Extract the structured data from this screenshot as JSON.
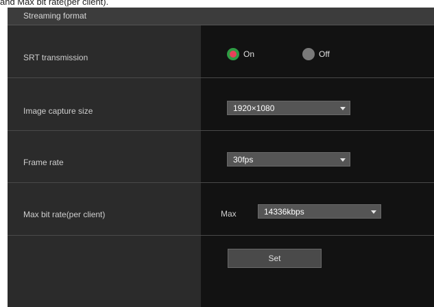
{
  "caption": "and Max bit rate(per client).",
  "section_title": "Streaming format",
  "srt": {
    "label": "SRT transmission",
    "on_label": "On",
    "off_label": "Off",
    "selected": "On"
  },
  "image_capture": {
    "label": "Image capture size",
    "value": "1920×1080"
  },
  "frame_rate": {
    "label": "Frame rate",
    "value": "30fps"
  },
  "max_bitrate": {
    "label": "Max bit rate(per client)",
    "prefix": "Max",
    "value": "14336kbps"
  },
  "set_label": "Set",
  "colors": {
    "radio_on": "#e8415a",
    "radio_on_ring": "#2f9c44",
    "radio_off": "#7a7a7a",
    "panel_bg": "#121212",
    "label_bg": "#2b2b2b"
  }
}
